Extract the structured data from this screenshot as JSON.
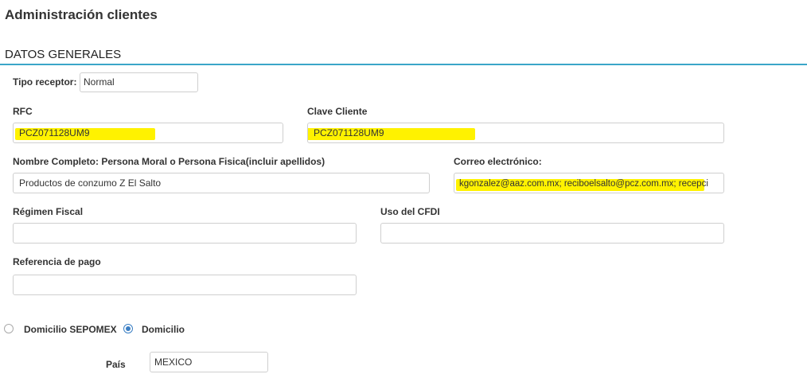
{
  "page": {
    "title": "Administración clientes"
  },
  "section": {
    "title": "DATOS GENERALES"
  },
  "form": {
    "tipo_receptor": {
      "label": "Tipo receptor:",
      "value": "Normal"
    },
    "rfc": {
      "label": "RFC",
      "value": "PCZ071128UM9"
    },
    "clave_cliente": {
      "label": "Clave Cliente",
      "value": "PCZ071128UM9"
    },
    "nombre_completo": {
      "label": "Nombre Completo: Persona Moral o Persona Fisica(incluir apellidos)",
      "value": "Productos de conzumo Z El Salto"
    },
    "correo": {
      "label": "Correo electrónico:",
      "value": "kgonzalez@aaz.com.mx; reciboelsalto@pcz.com.mx; recepci"
    },
    "regimen_fiscal": {
      "label": "Régimen Fiscal",
      "value": ""
    },
    "uso_cfdi": {
      "label": "Uso del CFDI",
      "value": ""
    },
    "referencia_pago": {
      "label": "Referencia de pago",
      "value": ""
    }
  },
  "domicilio": {
    "options": [
      {
        "label": "Domicilio SEPOMEX",
        "selected": false
      },
      {
        "label": "Domicilio",
        "selected": true
      }
    ]
  },
  "pais": {
    "label": "País",
    "value": "MEXICO"
  },
  "colors": {
    "accent": "#3aa6c8",
    "highlight": "#fff200",
    "radio": "#3b7fc4"
  }
}
